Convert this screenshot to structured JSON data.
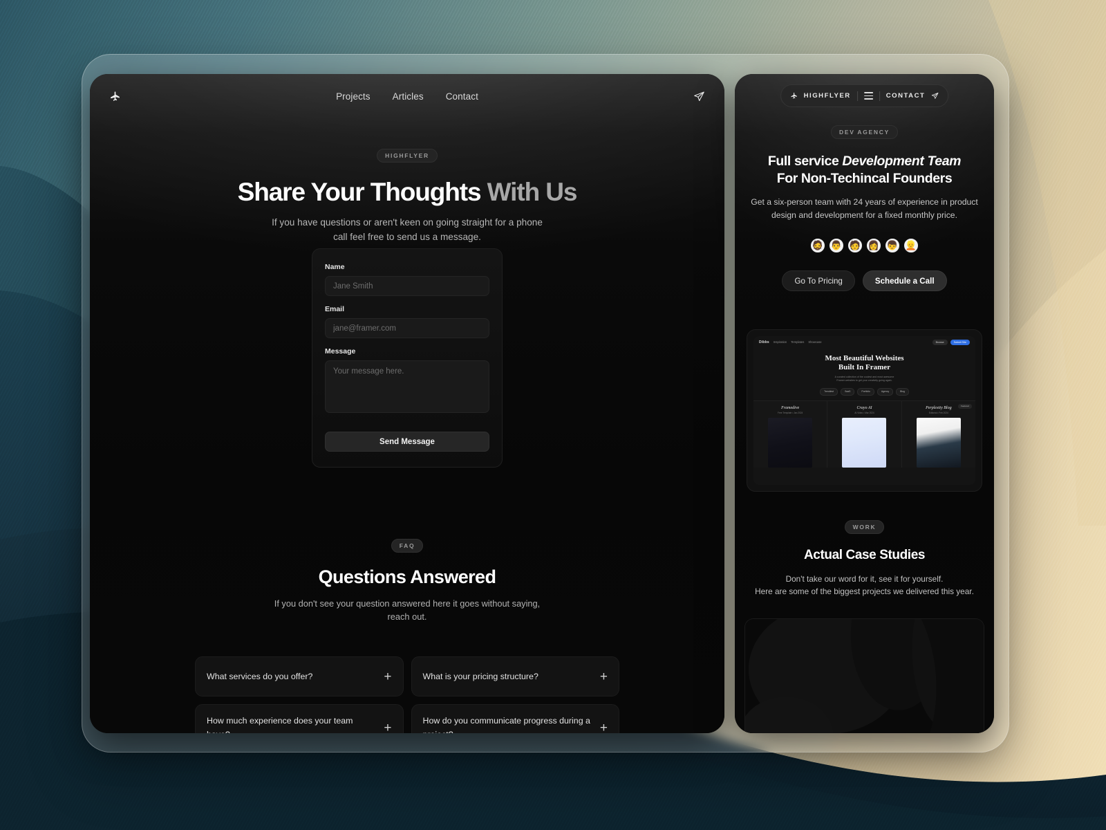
{
  "wallpaper": {
    "gradient_left": "#2d5866",
    "gradient_right": "#f0dcb4",
    "mountain_color": "#1d3a4a"
  },
  "left_panel": {
    "topbar": {
      "logo_icon": "airplane-icon",
      "nav": [
        {
          "label": "Projects"
        },
        {
          "label": "Articles"
        },
        {
          "label": "Contact"
        }
      ],
      "send_icon": "send-icon"
    },
    "hero": {
      "badge": "HIGHFLYER",
      "title_bright": "Share Your Thoughts",
      "title_dim": " With Us",
      "subtitle_line1": "If you have questions or aren't keen on going straight for a phone",
      "subtitle_line2": "call feel free to send us a message."
    },
    "form": {
      "name_label": "Name",
      "name_placeholder": "Jane Smith",
      "name_value": "",
      "email_label": "Email",
      "email_placeholder": "jane@framer.com",
      "email_value": "",
      "message_label": "Message",
      "message_placeholder": "Your message here.",
      "message_value": "",
      "submit_label": "Send Message"
    },
    "faq": {
      "badge": "FAQ",
      "title": "Questions Answered",
      "subtitle_line1": "If you don't see your question answered here it goes without saying,",
      "subtitle_line2": "reach out.",
      "items": [
        {
          "question": "What services do you offer?",
          "toggle": "+"
        },
        {
          "question": "What is your pricing structure?",
          "toggle": "+"
        },
        {
          "question": "How much experience does your team have?",
          "toggle": "+"
        },
        {
          "question": "How do you communicate progress during a project?",
          "toggle": "+"
        }
      ]
    }
  },
  "right_panel": {
    "nav": {
      "brand": "HIGHFLYER",
      "brand_icon": "airplane-icon",
      "menu_icon": "hamburger-icon",
      "contact": "CONTACT",
      "contact_icon": "send-icon"
    },
    "hero": {
      "badge": "DEV AGENCY",
      "title_plain": "Full service ",
      "title_italic": "Development Team",
      "title_line2": "For Non-Techincal Founders",
      "subtitle_line1": "Get a six-person team with 24 years of experience in product",
      "subtitle_line2": "design and development for a fixed monthly price.",
      "avatars": [
        "🧔",
        "👨",
        "🧑",
        "👩",
        "👦",
        "👱"
      ],
      "btn_secondary": "Go To Pricing",
      "btn_primary": "Schedule a Call"
    },
    "preview": {
      "logo": "Dibbs",
      "nav_links": [
        "Inspiration",
        "Templates",
        "Showcase"
      ],
      "chip_secondary": "Browse",
      "chip_primary": "Submit Site",
      "headline_line1": "Most Beautiful Websites",
      "headline_line2": "Built In Framer",
      "paragraph_line1": "A curated collection of the coolest and most awesome",
      "paragraph_line2": "Framer websites to get your creativity going again.",
      "tabs": [
        "Trendiest",
        "SaaS",
        "Portfolio",
        "Agency",
        "Blog"
      ],
      "cards": [
        {
          "title": "Framedive",
          "subtitle": "Free Template • Jan 2024",
          "badge": ""
        },
        {
          "title": "Crayo AI",
          "subtitle": "AI Video • Mar 2024",
          "badge": ""
        },
        {
          "title": "Perplexity Blog",
          "subtitle": "Editorial • Feb 2024",
          "badge": "Featured"
        }
      ]
    },
    "work": {
      "badge": "WORK",
      "title": "Actual Case Studies",
      "subtitle_line1": "Don't take our word for it, see it for yourself.",
      "subtitle_line2": "Here are some of the biggest projects we delivered this year."
    }
  }
}
